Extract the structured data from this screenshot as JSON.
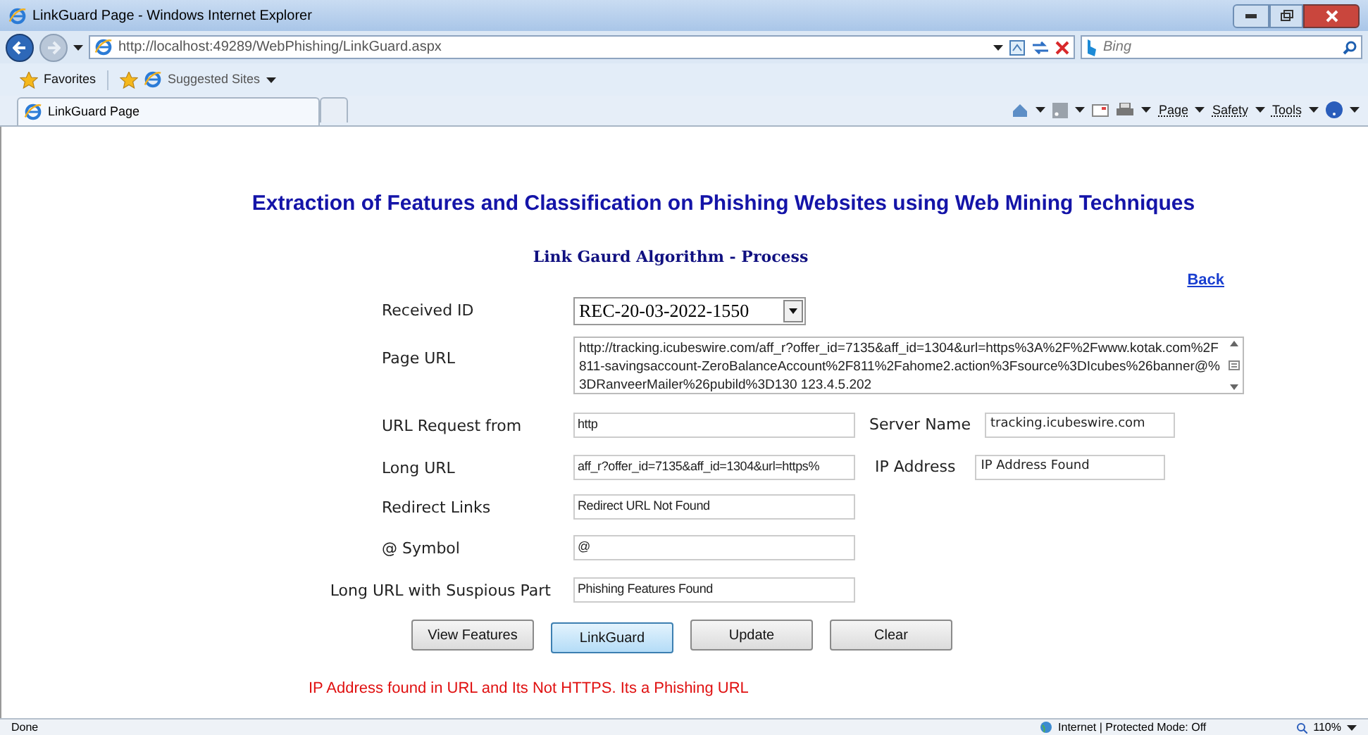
{
  "browser": {
    "title": "LinkGuard Page - Windows Internet Explorer",
    "address": "http://localhost:49289/WebPhishing/LinkGuard.aspx",
    "search_placeholder": "Bing",
    "favorites": "Favorites",
    "suggested_sites": "Suggested Sites",
    "tabs": [
      {
        "label": "LinkGuard Page",
        "selected": true
      }
    ],
    "commands": [
      "Page",
      "Safety",
      "Tools"
    ],
    "status": "Done",
    "zone": "Internet | Protected Mode: Off",
    "zoom": "110%"
  },
  "page": {
    "heading": "Extraction of Features and Classification on Phishing Websites using Web Mining Techniques",
    "subheading": "Link Gaurd Algorithm - Process",
    "back_link": "Back",
    "fields": [
      {
        "kind": "select",
        "label": "Received ID",
        "value": "REC-20-03-2022-1550"
      },
      {
        "kind": "textarea",
        "label": "Page URL",
        "value": "http://tracking.icubeswire.com/aff_r?offer_id=7135&aff_id=1304&url=https%3A%2F%2Fwww.kotak.com%2F811-savingsaccount-ZeroBalanceAccount%2F811%2Fahome2.action%3Fsource%3DIcubes%26banner@%3DRanveerMailer%26pubild%3D130 123.4.5.202"
      },
      {
        "kind": "text",
        "label": "URL Request from",
        "value": "http",
        "side": {
          "label": "Server Name",
          "value": "tracking.icubeswire.com"
        }
      },
      {
        "kind": "text",
        "label": "Long URL",
        "value": "aff_r?offer_id=7135&aff_id=1304&url=https%",
        "side": {
          "label": "IP Address",
          "value": "IP Address Found"
        }
      },
      {
        "kind": "text",
        "label": "Redirect Links",
        "value": "Redirect URL Not Found"
      },
      {
        "kind": "text",
        "label": "@ Symbol",
        "value": "@"
      },
      {
        "kind": "text",
        "label": "Long URL with Suspious Part",
        "value": "Phishing Features Found"
      }
    ],
    "buttons": [
      {
        "label": "View Features",
        "selected": false
      },
      {
        "label": "LinkGuard",
        "selected": true
      },
      {
        "label": "Update",
        "selected": false
      },
      {
        "label": "Clear",
        "selected": false
      }
    ],
    "message": "IP Address found in URL and Its Not HTTPS. Its a Phishing URL"
  }
}
